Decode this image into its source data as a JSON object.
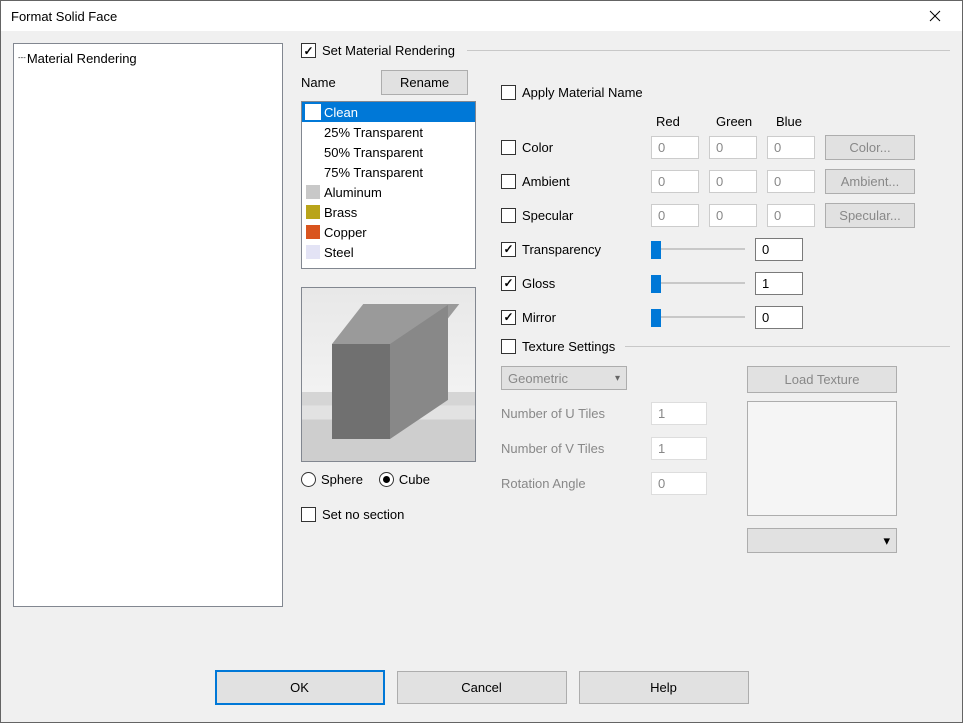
{
  "window": {
    "title": "Format Solid Face"
  },
  "tree": {
    "item": "Material Rendering"
  },
  "set_material": {
    "label": "Set Material Rendering",
    "checked": true
  },
  "name_section": {
    "label": "Name",
    "rename_btn": "Rename"
  },
  "materials": [
    {
      "label": "Clean",
      "color": "#ffffff",
      "selected": true
    },
    {
      "label": "25% Transparent",
      "color": "#ffffff"
    },
    {
      "label": "50% Transparent",
      "color": "#ffffff"
    },
    {
      "label": "75% Transparent",
      "color": "#ffffff"
    },
    {
      "label": "Aluminum",
      "color": "#c8c8c8"
    },
    {
      "label": "Brass",
      "color": "#b9a41a"
    },
    {
      "label": "Copper",
      "color": "#d9541e"
    },
    {
      "label": "Steel",
      "color": "#e3e3f5"
    }
  ],
  "shape": {
    "sphere": "Sphere",
    "cube": "Cube",
    "selected": "cube"
  },
  "no_section": {
    "label": "Set no section",
    "checked": false
  },
  "apply_name": {
    "label": "Apply Material Name",
    "checked": false
  },
  "rgb_headers": {
    "r": "Red",
    "g": "Green",
    "b": "Blue"
  },
  "props": {
    "color": {
      "label": "Color",
      "checked": false,
      "r": "0",
      "g": "0",
      "b": "0",
      "btn": "Color..."
    },
    "ambient": {
      "label": "Ambient",
      "checked": false,
      "r": "0",
      "g": "0",
      "b": "0",
      "btn": "Ambient..."
    },
    "specular": {
      "label": "Specular",
      "checked": false,
      "r": "0",
      "g": "0",
      "b": "0",
      "btn": "Specular..."
    },
    "transparency": {
      "label": "Transparency",
      "checked": true,
      "value": "0"
    },
    "gloss": {
      "label": "Gloss",
      "checked": true,
      "value": "1"
    },
    "mirror": {
      "label": "Mirror",
      "checked": true,
      "value": "0"
    }
  },
  "texture": {
    "label": "Texture Settings",
    "checked": false,
    "combo": "Geometric",
    "load_btn": "Load Texture",
    "u_tiles_label": "Number of U Tiles",
    "u_tiles": "1",
    "v_tiles_label": "Number of V Tiles",
    "v_tiles": "1",
    "rotation_label": "Rotation Angle",
    "rotation": "0"
  },
  "footer": {
    "ok": "OK",
    "cancel": "Cancel",
    "help": "Help"
  }
}
